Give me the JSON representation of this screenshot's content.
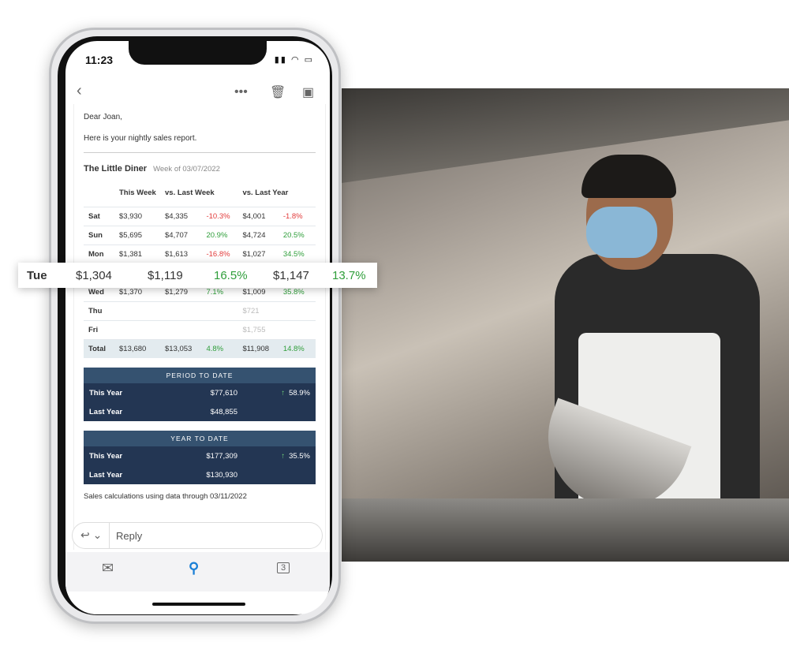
{
  "status": {
    "time": "11:23"
  },
  "toolbar": {
    "back": "back",
    "more": "more",
    "trash": "trash",
    "archive": "archive"
  },
  "email": {
    "greeting": "Dear Joan,",
    "intro": "Here is your nightly sales report.",
    "restaurant": "The Little Diner",
    "week": "Week of 03/07/2022",
    "headers": [
      "",
      "This Week",
      "vs. Last Week",
      "",
      "vs. Last Year",
      ""
    ],
    "rows": [
      {
        "day": "Sat",
        "tw": "$3,930",
        "lw": "$4,335",
        "lwp": "-10.3%",
        "lws": "neg",
        "ly": "$4,001",
        "lyp": "-1.8%",
        "lys": "neg"
      },
      {
        "day": "Sun",
        "tw": "$5,695",
        "lw": "$4,707",
        "lwp": "20.9%",
        "lws": "pos",
        "ly": "$4,724",
        "lyp": "20.5%",
        "lys": "pos"
      },
      {
        "day": "Mon",
        "tw": "$1,381",
        "lw": "$1,613",
        "lwp": "-16.8%",
        "lws": "neg",
        "ly": "$1,027",
        "lyp": "34.5%",
        "lys": "pos"
      },
      {
        "day": "Tue",
        "tw": "$1,304",
        "lw": "$1,119",
        "lwp": "16.5%",
        "lws": "pos",
        "ly": "$1,147",
        "lyp": "13.7%",
        "lys": "pos"
      },
      {
        "day": "Wed",
        "tw": "$1,370",
        "lw": "$1,279",
        "lwp": "7.1%",
        "lws": "pos",
        "ly": "$1,009",
        "lyp": "35.8%",
        "lys": "pos"
      },
      {
        "day": "Thu",
        "tw": "",
        "lw": "",
        "lwp": "",
        "lws": "",
        "ly": "$721",
        "lyp": "",
        "lys": "mut"
      },
      {
        "day": "Fri",
        "tw": "",
        "lw": "",
        "lwp": "",
        "lws": "",
        "ly": "$1,755",
        "lyp": "",
        "lys": "mut"
      }
    ],
    "total": {
      "day": "Total",
      "tw": "$13,680",
      "lw": "$13,053",
      "lwp": "4.8%",
      "ly": "$11,908",
      "lyp": "14.8%"
    },
    "ptd": {
      "title": "PERIOD TO DATE",
      "this_label": "This Year",
      "this_value": "$77,610",
      "change": "58.9%",
      "last_label": "Last Year",
      "last_value": "$48,855"
    },
    "ytd": {
      "title": "YEAR TO DATE",
      "this_label": "This Year",
      "this_value": "$177,309",
      "change": "35.5%",
      "last_label": "Last Year",
      "last_value": "$130,930"
    },
    "footer": "Sales calculations using data through 03/11/2022"
  },
  "reply": {
    "label": "Reply"
  },
  "tabs": {
    "calendar_day": "3"
  },
  "colors": {
    "negative": "#e23b3b",
    "positive": "#2f9e3a",
    "box": "#233653"
  }
}
